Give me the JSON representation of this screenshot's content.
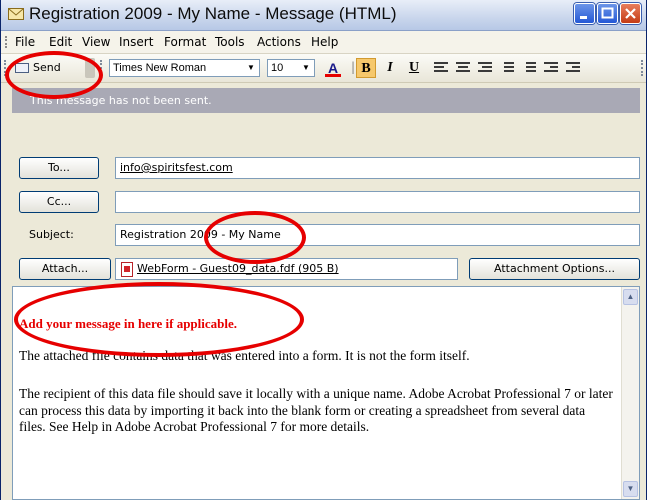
{
  "window": {
    "title": "Registration 2009 - My Name - Message (HTML)"
  },
  "menu": {
    "items": [
      "File",
      "Edit",
      "View",
      "Insert",
      "Format",
      "Tools",
      "Actions",
      "Help"
    ]
  },
  "toolbar": {
    "send_label": "Send",
    "font_name": "Times New Roman",
    "font_size": "10",
    "bold": "B",
    "italic": "I",
    "underline": "U",
    "font_color": "A"
  },
  "notice": "This message has not been sent.",
  "fields": {
    "to_button": "To...",
    "to_value": "info@spiritsfest.com",
    "cc_button": "Cc...",
    "cc_value": "",
    "subject_label": "Subject:",
    "subject_value": "Registration 2009 - My Name",
    "attach_button": "Attach...",
    "attachment_name": "WebForm - Guest09_data.fdf (905 B)",
    "attachment_options_button": "Attachment Options..."
  },
  "body": {
    "intro": "Add your message in here if applicable.",
    "para1": "The attached file contains data that was entered into a form. It is not the form itself.",
    "para2": "The recipient of this data file should save it locally with a unique name. Adobe Acrobat Professional 7 or later can process this data by importing it back into the blank form or creating a spreadsheet from several data files. See Help in Adobe Acrobat Professional 7 for more details."
  },
  "colors": {
    "annotation": "#e60000",
    "notice_bg": "#a9a9b5",
    "title_bar": "#c9d6ec"
  },
  "icons": {
    "title": "message-icon",
    "send": "envelope-icon",
    "attachment": "pdf-icon"
  }
}
